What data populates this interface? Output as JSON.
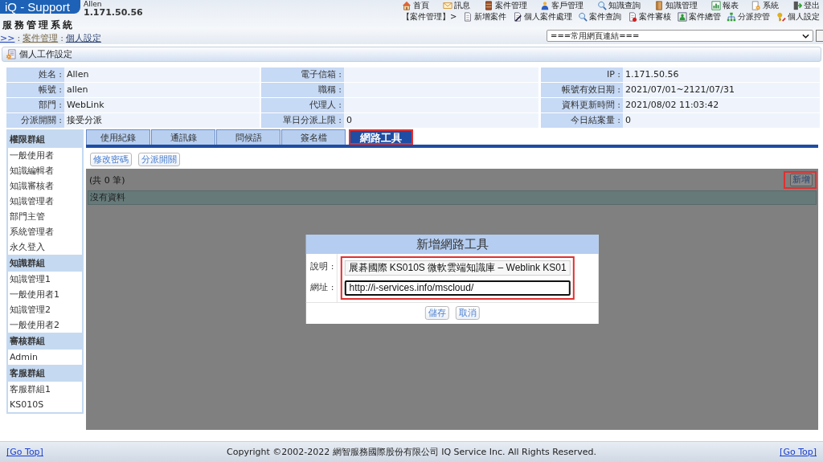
{
  "header": {
    "logo": "iQ - Support",
    "system_name": "服務管理系統",
    "user_name": "Allen",
    "user_ip": "1.171.50.56",
    "breadcrumb": [
      {
        "label": ">>"
      },
      {
        "label": "案件管理"
      },
      {
        "label": "個人設定"
      }
    ],
    "breadcrumb_separator": ":"
  },
  "main_menu": [
    {
      "label": "首頁"
    },
    {
      "label": "訊息"
    },
    {
      "label": "案件管理"
    },
    {
      "label": "客戶管理"
    },
    {
      "label": "知識查詢"
    },
    {
      "label": "知識管理"
    },
    {
      "label": "報表"
    },
    {
      "label": "系統"
    },
    {
      "label": "登出"
    }
  ],
  "sub_menu": {
    "section": "【案件管理】>",
    "items": [
      {
        "label": "新增案件"
      },
      {
        "label": "個人案件處理"
      },
      {
        "label": "案件查詢"
      },
      {
        "label": "案件審核"
      },
      {
        "label": "案件總管"
      },
      {
        "label": "分派控管"
      },
      {
        "label": "個人設定"
      }
    ]
  },
  "quick_links": {
    "value": "===常用網頁連結==="
  },
  "section_title": "個人工作設定",
  "profile": [
    [
      {
        "label": "姓名 :",
        "value": "Allen"
      },
      {
        "label": "電子信箱 :"
      },
      {
        "label": "IP :",
        "value": "1.171.50.56"
      }
    ],
    [
      {
        "label": "帳號 :",
        "value": "allen"
      },
      {
        "label": "職稱 :"
      },
      {
        "label": "帳號有效日期 :",
        "value": "2021/07/01~2121/07/31"
      }
    ],
    [
      {
        "label": "部門 :",
        "value": "WebLink"
      },
      {
        "label": "代理人 :"
      },
      {
        "label": "資料更新時間 :",
        "value": "2021/08/02 11:03:42"
      }
    ],
    [
      {
        "label": "分派開關 :",
        "value": "接受分派"
      },
      {
        "label": "單日分派上限 :",
        "value": "0"
      },
      {
        "label": "今日結案量 :",
        "value": "0"
      }
    ]
  ],
  "sidebar": {
    "groups": [
      {
        "title": "權限群組",
        "items": [
          "一般使用者",
          "知識編輯者",
          "知識審核者",
          "知識管理者",
          "部門主管",
          "系統管理者",
          "永久登入"
        ]
      },
      {
        "title": "知識群組",
        "items": [
          "知識管理1",
          "一般使用者1",
          "知識管理2",
          "一般使用者2"
        ]
      },
      {
        "title": "審核群組",
        "items": [
          "Admin"
        ]
      },
      {
        "title": "客服群組",
        "items": [
          "客服群組1",
          "KS010S"
        ]
      }
    ]
  },
  "tabs": [
    {
      "label": "使用紀錄",
      "selected": false,
      "highlighted": false
    },
    {
      "label": "通訊錄",
      "selected": false,
      "highlighted": false
    },
    {
      "label": "問候語",
      "selected": false,
      "highlighted": false
    },
    {
      "label": "簽名檔",
      "selected": false,
      "highlighted": false
    },
    {
      "label": "網路工具",
      "selected": true,
      "highlighted": true
    }
  ],
  "actions": [
    "修改密碼",
    "分派開關"
  ],
  "list": {
    "count": "(共 0 筆)",
    "add_button": {
      "label": "新增",
      "highlighted": true
    },
    "empty_message": "沒有資料"
  },
  "dialog": {
    "title": "新增網路工具",
    "highlighted": true,
    "fields": [
      {
        "label": "說明 :",
        "value": "展碁國際 KS010S 微軟雲端知識庫 – Weblink KS01",
        "focused": false
      },
      {
        "label": "網址 :",
        "value": "http://i-services.info/mscloud/",
        "focused": true
      }
    ],
    "buttons": [
      "儲存",
      "取消"
    ]
  },
  "footer": {
    "left_link": "[Go Top]",
    "copyright": "Copyright ©2002-2022 網智服務國際股份有限公司 IQ Service Inc. All Rights Reserved.",
    "right_link": "[Go Top]"
  }
}
